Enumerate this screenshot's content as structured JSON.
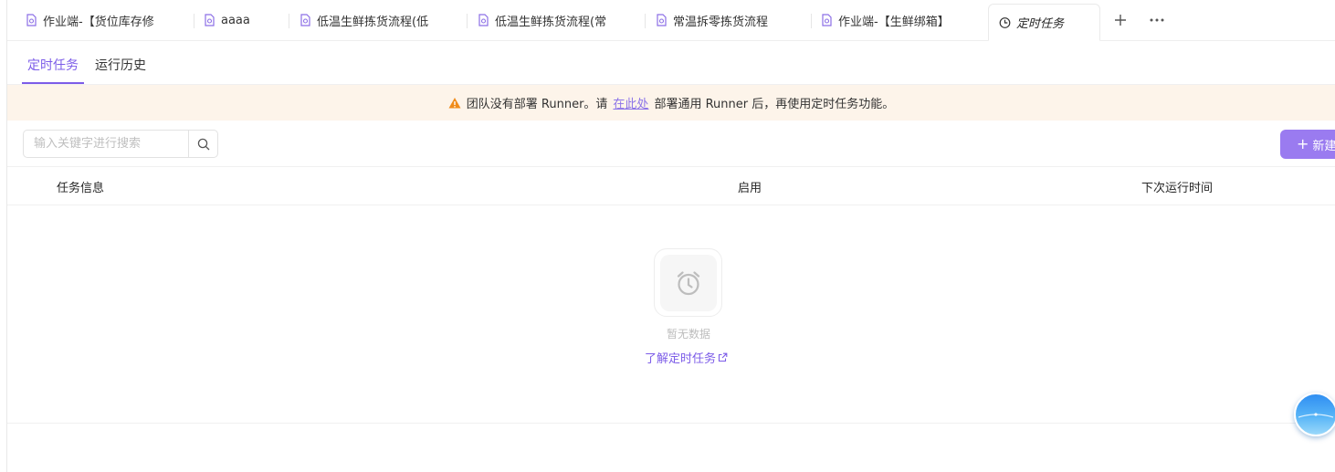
{
  "tabs": [
    {
      "label": "作业端-【货位库存修",
      "icon": "flow-doc-icon"
    },
    {
      "label": "aaaa",
      "icon": "flow-doc-icon"
    },
    {
      "label": "低温生鲜拣货流程(低",
      "icon": "flow-doc-icon"
    },
    {
      "label": "低温生鲜拣货流程(常",
      "icon": "flow-doc-icon"
    },
    {
      "label": "常温拆零拣货流程",
      "icon": "flow-doc-icon"
    },
    {
      "label": "作业端-【生鲜绑箱】",
      "icon": "flow-doc-icon"
    },
    {
      "label": "定时任务",
      "icon": "clock-icon",
      "active": true
    }
  ],
  "tabbar": {
    "add_icon": "plus-icon",
    "more_icon": "more-icon"
  },
  "subtabs": [
    {
      "label": "定时任务",
      "active": true
    },
    {
      "label": "运行历史",
      "active": false
    }
  ],
  "banner": {
    "icon": "warning-icon",
    "text_before": "团队没有部署 Runner。请",
    "link": "在此处",
    "text_after": "部署通用 Runner 后，再使用定时任务功能。"
  },
  "search": {
    "placeholder": "输入关键字进行搜索",
    "value": "",
    "icon": "search-icon"
  },
  "new_button": {
    "label": "新建",
    "icon": "plus-icon"
  },
  "table": {
    "columns": [
      "任务信息",
      "启用",
      "下次运行时间"
    ],
    "rows": []
  },
  "empty": {
    "icon": "alarm-clock-icon",
    "text": "暂无数据",
    "link": "了解定时任务",
    "link_icon": "external-link-icon"
  },
  "colors": {
    "accent": "#7c5ce8",
    "button": "#9a7bf0",
    "banner_bg": "#fdf4ea",
    "warning": "#f08c1a",
    "tab_icon": "#8c6fe6"
  }
}
